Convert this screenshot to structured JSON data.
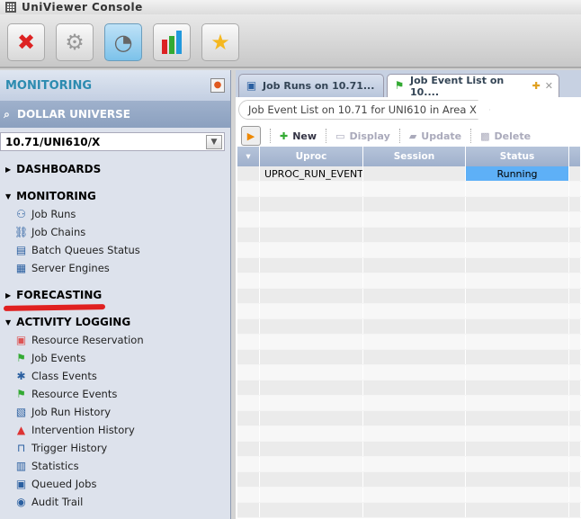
{
  "window": {
    "title": "UniViewer Console"
  },
  "toolbar": {
    "buttons": [
      {
        "icon": "tools-icon"
      },
      {
        "icon": "settings-gear-icon"
      },
      {
        "icon": "gauge-icon",
        "active": true
      },
      {
        "icon": "bar-chart-icon"
      },
      {
        "icon": "star-icon"
      }
    ]
  },
  "sidebar": {
    "title": "MONITORING",
    "node": "DOLLAR UNIVERSE",
    "selected_node": "10.71/UNI610/X",
    "sections": [
      {
        "label": "DASHBOARDS",
        "expanded": false,
        "items": []
      },
      {
        "label": "MONITORING",
        "expanded": true,
        "items": [
          "Job Runs",
          "Job Chains",
          "Batch Queues Status",
          "Server Engines"
        ]
      },
      {
        "label": "FORECASTING",
        "expanded": false,
        "items": []
      },
      {
        "label": "ACTIVITY LOGGING",
        "expanded": true,
        "items": [
          "Resource Reservation",
          "Job Events",
          "Class Events",
          "Resource Events",
          "Job Run History",
          "Intervention History",
          "Trigger History",
          "Statistics",
          "Queued Jobs",
          "Audit Trail"
        ]
      }
    ]
  },
  "tabs": [
    {
      "label": "Job Runs on 10.71..."
    },
    {
      "label": "Job Event List on 10....",
      "active": true
    }
  ],
  "breadcrumb": "Job Event List on 10.71 for UNI610 in Area X",
  "actions": {
    "new": "New",
    "display": "Display",
    "update": "Update",
    "delete": "Delete"
  },
  "table": {
    "columns": [
      "Uproc",
      "Session",
      "Status"
    ],
    "rows": [
      {
        "uproc": "UPROC_RUN_EVENT",
        "session": "",
        "status": "Running"
      }
    ]
  },
  "colors": {
    "running": "#5eb0f7",
    "accent": "#2c8bb0",
    "annotation": "#e02020"
  }
}
